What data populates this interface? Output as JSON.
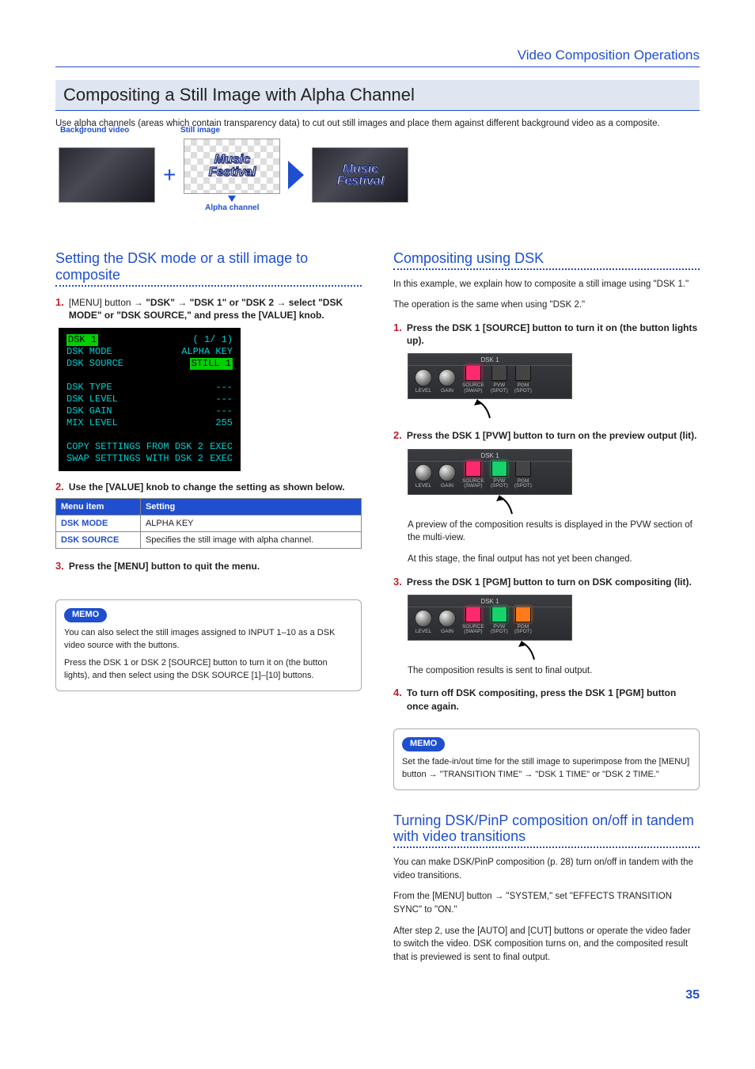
{
  "header": {
    "section": "Video Composition Operations"
  },
  "title": "Compositing a Still Image with Alpha Channel",
  "intro": "Use alpha channels (areas which contain transparency data) to cut out still images and place them against different background video as a composite.",
  "illus": {
    "bg_label": "Background video",
    "still_label": "Still image",
    "alpha_label": "Alpha channel",
    "music": "Music",
    "festival": "Festival"
  },
  "left": {
    "heading": "Setting the DSK mode or a still image to composite",
    "step1_a": "[MENU] button ",
    "step1_b": " \"DSK\" ",
    "step1_c": " \"DSK 1\" or \"DSK 2 ",
    "step1_d": " select \"DSK MODE\" or \"DSK SOURCE,\" and press the [VALUE] knob.",
    "screen": {
      "title": "DSK 1",
      "page": "( 1/ 1)",
      "rows": {
        "mode_label": "DSK MODE",
        "mode_val": "ALPHA KEY",
        "source_label": "DSK SOURCE",
        "source_val": "STILL 1",
        "type": "DSK TYPE",
        "type_v": "---",
        "level": "DSK LEVEL",
        "level_v": "---",
        "gain": "DSK GAIN",
        "gain_v": "---",
        "mix": "MIX LEVEL",
        "mix_v": "255",
        "copy": "COPY SETTINGS FROM DSK 2",
        "copy_v": "EXEC",
        "swap": "SWAP SETTINGS WITH DSK 2",
        "swap_v": "EXEC"
      }
    },
    "step2": "Use the [VALUE] knob to change the setting as shown below.",
    "table": {
      "h1": "Menu item",
      "h2": "Setting",
      "r1a": "DSK MODE",
      "r1b": "ALPHA KEY",
      "r2a": "DSK SOURCE",
      "r2b": "Specifies the still image with alpha channel."
    },
    "step3": "Press the [MENU] button to quit the menu.",
    "memo": {
      "tag": "MEMO",
      "p1": "You can also select the still images assigned to INPUT 1–10 as a DSK video source with the buttons.",
      "p2": "Press the DSK 1 or DSK 2 [SOURCE] button to turn it on (the button lights), and then select using the DSK SOURCE [1]–[10] buttons."
    }
  },
  "right": {
    "heading": "Compositing using DSK",
    "intro1": "In this example, we explain how to composite a still image using \"DSK 1.\"",
    "intro2": "The operation is the same when using \"DSK 2.\"",
    "step1": "Press the DSK 1 [SOURCE] button to turn it on (the button lights up).",
    "step2": "Press the DSK 1 [PVW] button to turn on the preview output (lit).",
    "step2_p1": "A preview of the composition results is displayed in the PVW section of the multi-view.",
    "step2_p2": "At this stage, the final output has not yet been changed.",
    "step3": "Press the DSK 1 [PGM] button to turn on DSK compositing (lit).",
    "step3_p": "The composition results is sent to final output.",
    "step4": "To turn off DSK compositing, press the DSK 1 [PGM] button once again.",
    "memo": {
      "tag": "MEMO",
      "p_a": "Set the fade-in/out time for the still image to superimpose from the [MENU] button ",
      "p_b": " \"TRANSITION TIME\" ",
      "p_c": " \"DSK 1 TIME\" or \"DSK 2 TIME.\""
    },
    "tandem": {
      "heading": "Turning DSK/PinP composition on/off in tandem with video transitions",
      "p1": "You can make DSK/PinP composition (p. 28) turn on/off in tandem with the video transitions.",
      "p2a": "From the [MENU] button ",
      "p2b": " \"SYSTEM,\" set \"EFFECTS TRANSITION SYNC\" to \"ON.\"",
      "p3": "After step 2, use the [AUTO] and [CUT] buttons or operate the video fader to switch the video. DSK composition turns on, and the composited result that is previewed is sent to final output."
    },
    "hw": {
      "title": "DSK 1",
      "level": "LEVEL",
      "gain": "GAIN",
      "source": "SOURCE",
      "swap": "(SWAP)",
      "pvw": "PVW",
      "spot1": "(SPOT)",
      "pgm": "PGM",
      "spot2": "(SPOT)"
    }
  },
  "page": "35"
}
